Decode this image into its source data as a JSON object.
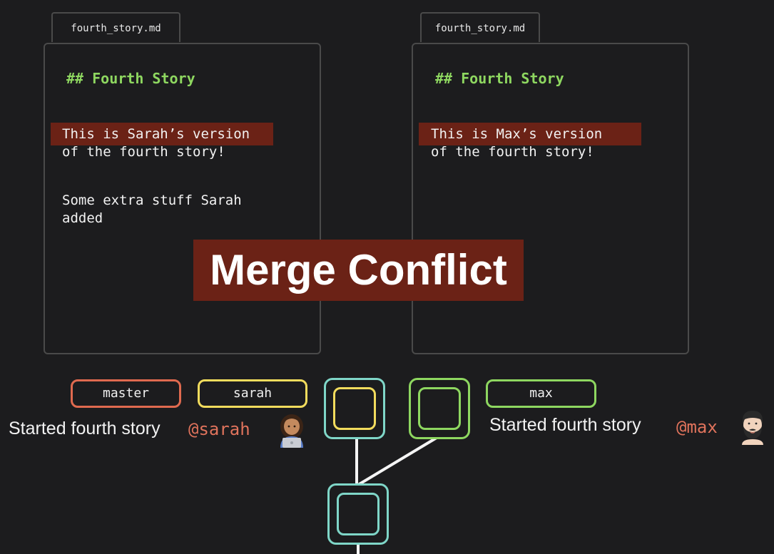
{
  "left_file": {
    "tab": "fourth_story.md",
    "heading": "## Fourth Story",
    "line1": "This is Sarah’s version",
    "line2": "of the fourth story!",
    "line3": "Some extra stuff Sarah",
    "line4": "added"
  },
  "right_file": {
    "tab": "fourth_story.md",
    "heading": "## Fourth Story",
    "line1": "This is Max’s version",
    "line2": "of the fourth story!"
  },
  "banner": "Merge Conflict",
  "branches": {
    "master": "master",
    "sarah": "sarah",
    "max": "max"
  },
  "commits": {
    "sarah_message": "Started fourth story",
    "sarah_handle": "@sarah",
    "max_message": "Started fourth story",
    "max_handle": "@max"
  },
  "icons": {
    "sarah_avatar": "woman-technologist-emoji",
    "max_avatar": "man-bearded-emoji"
  },
  "colors": {
    "master": "#e06a4f",
    "sarah": "#f2dc5d",
    "max": "#8ed760",
    "commit_teal": "#7fd6c8",
    "conflict_red": "#6b2216"
  }
}
